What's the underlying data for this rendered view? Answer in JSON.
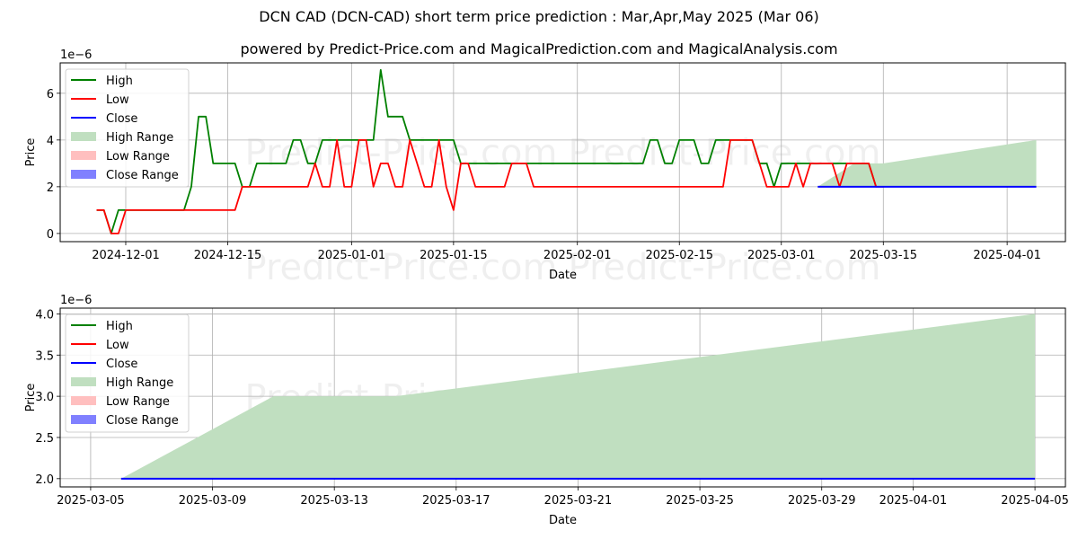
{
  "header": {
    "title": "DCN CAD (DCN-CAD) short term price prediction : Mar,Apr,May 2025 (Mar 06)",
    "subtitle": "powered by Predict-Price.com and MagicalPrediction.com and MagicalAnalysis.com"
  },
  "watermark": "Predict-Price.com",
  "colors": {
    "high": "#008000",
    "low": "#ff0000",
    "close": "#0000ff",
    "high_range": "#c0dfc0",
    "low_range": "#ffbfbf",
    "close_range": "#8080ff",
    "grid": "#b0b0b0"
  },
  "legend": {
    "placement": "top-left",
    "entries": [
      "High",
      "Low",
      "Close",
      "High Range",
      "Low Range",
      "Close Range"
    ]
  },
  "chart_data": [
    {
      "type": "line",
      "title": "",
      "xlabel": "Date",
      "ylabel": "Price",
      "y_scale_label": "1e−6",
      "grid": true,
      "xlim": [
        "2024-11-22",
        "2025-04-09"
      ],
      "ylim": [
        -0.35,
        7.3
      ],
      "yticks": [
        0,
        2,
        4,
        6
      ],
      "xticks": [
        "2024-12-01",
        "2024-12-15",
        "2025-01-01",
        "2025-01-15",
        "2025-02-01",
        "2025-02-15",
        "2025-03-01",
        "2025-03-15",
        "2025-04-01"
      ],
      "history_start": "2024-11-27",
      "series": [
        {
          "name": "High",
          "values": [
            1,
            1,
            0,
            1,
            1,
            1,
            1,
            1,
            1,
            1,
            1,
            1,
            1,
            2,
            5,
            5,
            3,
            3,
            3,
            3,
            2,
            2,
            3,
            3,
            3,
            3,
            3,
            4,
            4,
            3,
            3,
            4,
            4,
            4,
            4,
            4,
            4,
            4,
            4,
            7,
            5,
            5,
            5,
            4,
            4,
            4,
            4,
            4,
            4,
            4,
            3,
            3,
            3,
            3,
            3,
            3,
            3,
            3,
            3,
            3,
            3,
            3,
            3,
            3,
            3,
            3,
            3,
            3,
            3,
            3,
            3,
            3,
            3,
            3,
            3,
            3,
            4,
            4,
            3,
            3,
            4,
            4,
            4,
            3,
            3,
            4,
            4,
            4,
            4,
            4,
            4,
            3,
            3,
            2,
            3,
            3,
            3,
            3,
            3,
            3,
            3,
            3,
            3,
            3,
            3,
            3,
            3,
            2
          ]
        },
        {
          "name": "Low",
          "values": [
            1,
            1,
            0,
            0,
            1,
            1,
            1,
            1,
            1,
            1,
            1,
            1,
            1,
            1,
            1,
            1,
            1,
            1,
            1,
            1,
            2,
            2,
            2,
            2,
            2,
            2,
            2,
            2,
            2,
            2,
            3,
            2,
            2,
            4,
            2,
            2,
            4,
            4,
            2,
            3,
            3,
            2,
            2,
            4,
            3,
            2,
            2,
            4,
            2,
            1,
            3,
            3,
            2,
            2,
            2,
            2,
            2,
            3,
            3,
            3,
            2,
            2,
            2,
            2,
            2,
            2,
            2,
            2,
            2,
            2,
            2,
            2,
            2,
            2,
            2,
            2,
            2,
            2,
            2,
            2,
            2,
            2,
            2,
            2,
            2,
            2,
            2,
            4,
            4,
            4,
            4,
            3,
            2,
            2,
            2,
            2,
            3,
            2,
            3,
            3,
            3,
            3,
            2,
            3,
            3,
            3,
            3,
            2,
            2
          ]
        },
        {
          "name": "Close",
          "start": "2025-03-06",
          "end": "2025-04-05",
          "values": [
            2,
            2
          ]
        },
        {
          "name": "High Range",
          "points": [
            [
              "2025-03-06",
              2,
              2
            ],
            [
              "2025-03-11",
              2,
              3
            ],
            [
              "2025-03-15",
              2,
              3
            ],
            [
              "2025-04-05",
              2,
              4
            ]
          ]
        }
      ]
    },
    {
      "type": "area",
      "title": "",
      "xlabel": "Date",
      "ylabel": "Price",
      "y_scale_label": "1e−6",
      "grid": true,
      "xlim": [
        "2025-03-04",
        "2025-04-06"
      ],
      "ylim": [
        1.9,
        4.07
      ],
      "yticks": [
        "2.0",
        "2.5",
        "3.0",
        "3.5",
        "4.0"
      ],
      "xticks": [
        "2025-03-05",
        "2025-03-09",
        "2025-03-13",
        "2025-03-17",
        "2025-03-21",
        "2025-03-25",
        "2025-03-29",
        "2025-04-01",
        "2025-04-05"
      ],
      "series": [
        {
          "name": "Close",
          "start": "2025-03-06",
          "end": "2025-04-05",
          "values": [
            2,
            2
          ]
        },
        {
          "name": "High Range",
          "points": [
            [
              "2025-03-06",
              2,
              2
            ],
            [
              "2025-03-11",
              2,
              3
            ],
            [
              "2025-03-15",
              2,
              3
            ],
            [
              "2025-04-05",
              2,
              4
            ]
          ]
        }
      ]
    }
  ]
}
